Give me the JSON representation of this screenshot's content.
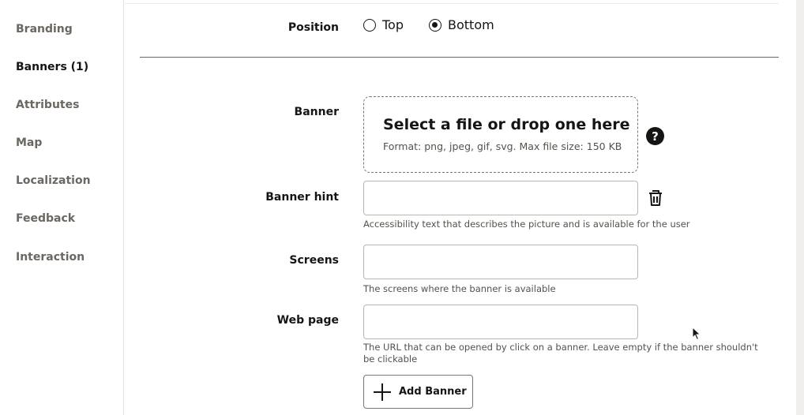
{
  "sidebar": {
    "items": [
      {
        "label": "Branding"
      },
      {
        "label": "Banners (1)"
      },
      {
        "label": "Attributes"
      },
      {
        "label": "Map"
      },
      {
        "label": "Localization"
      },
      {
        "label": "Feedback"
      },
      {
        "label": "Interaction"
      }
    ],
    "active": "Banners (1)"
  },
  "position": {
    "label": "Position",
    "options": [
      {
        "label": "Top",
        "checked": false
      },
      {
        "label": "Bottom",
        "checked": true
      }
    ]
  },
  "banner": {
    "label": "Banner",
    "dropzone_title": "Select a file or drop one here",
    "dropzone_format": "Format: png, jpeg, gif, svg. Max file size: 150 KB",
    "help_icon_glyph": "?"
  },
  "banner_hint": {
    "label": "Banner hint",
    "value": "",
    "hint": "Accessibility text that describes the picture and is available for the user"
  },
  "screens": {
    "label": "Screens",
    "value": "",
    "hint": "The screens where the banner is available"
  },
  "web_page": {
    "label": "Web page",
    "value": "",
    "hint": "The URL that can be opened by click on a banner. Leave empty if the banner shouldn't be clickable"
  },
  "add_banner": {
    "label": "Add Banner"
  },
  "colors": {
    "text": "#161513",
    "muted_text": "#6b6762",
    "border": "#b9b6b2"
  },
  "icons": {
    "help": "help-icon",
    "delete": "trash-icon",
    "add": "plus-icon",
    "pointer": "mouse-cursor-icon"
  }
}
